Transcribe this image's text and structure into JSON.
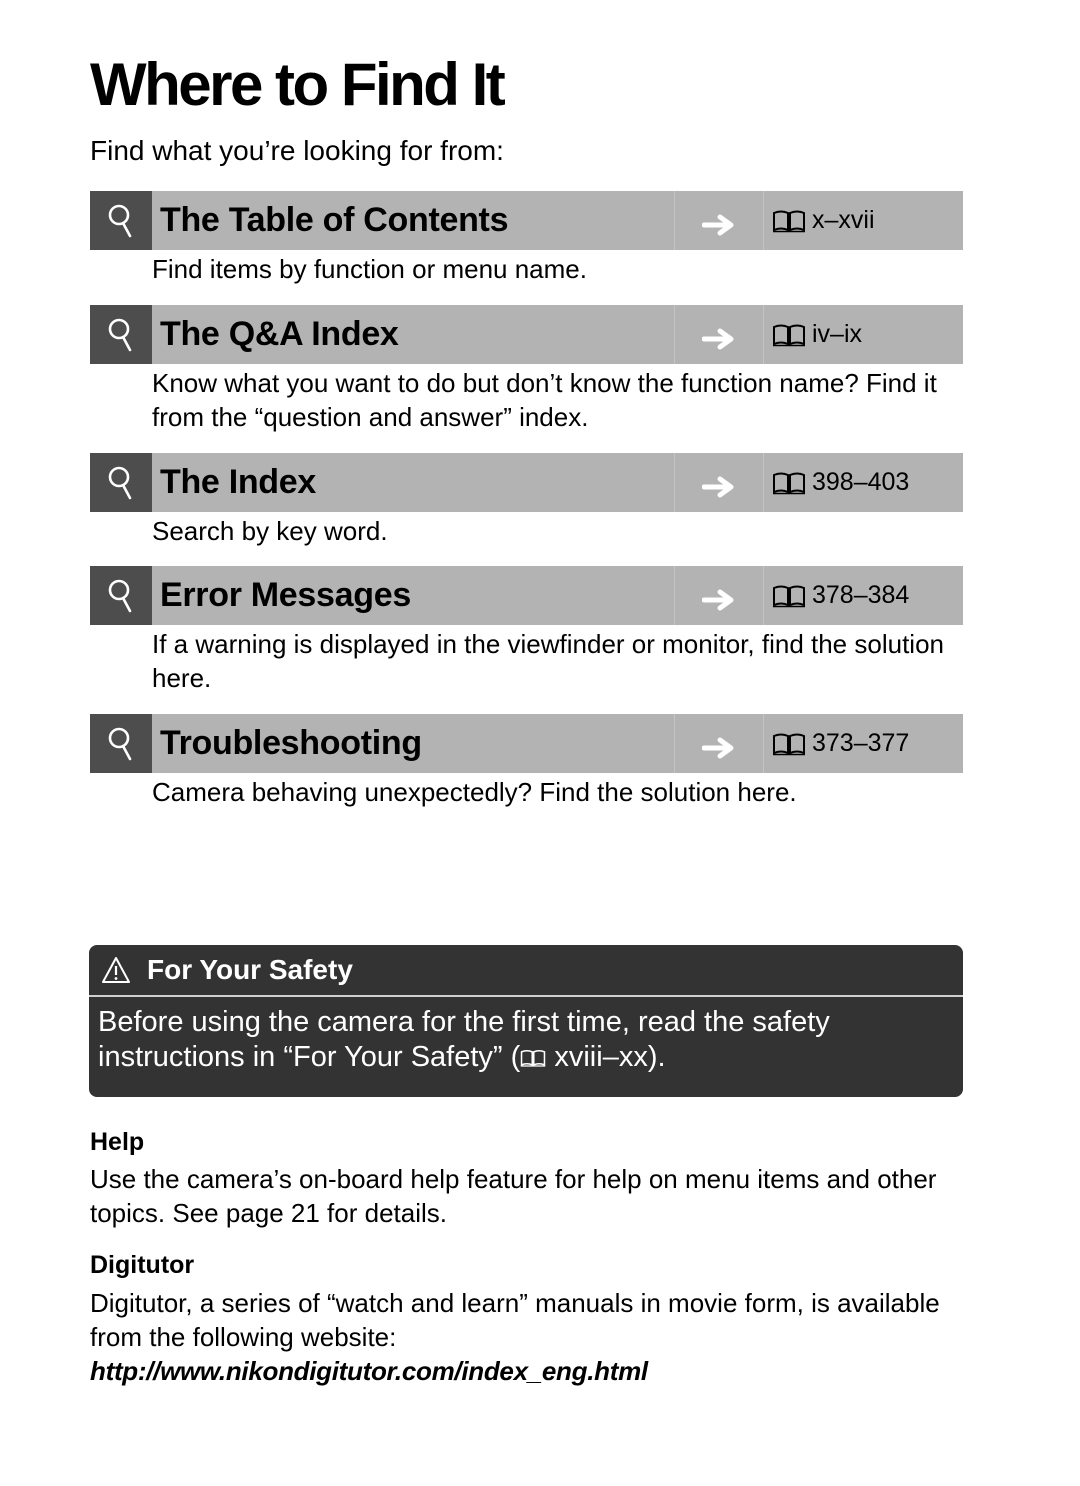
{
  "page": {
    "title": "Where to Find It",
    "intro": "Find what you’re looking for from:"
  },
  "entries": [
    {
      "icon": "magnifier-icon",
      "title": "The Table of Contents",
      "arrow": "right-arrow-icon",
      "page_icon": "book-icon",
      "pages": "x–xvii",
      "description": "Find items by function or menu name."
    },
    {
      "icon": "magnifier-icon",
      "title": "The Q&A Index",
      "arrow": "right-arrow-icon",
      "page_icon": "book-icon",
      "pages": "iv–ix",
      "description": "Know what you want to do but don’t know the function name?  Find it from the “question and answer” index."
    },
    {
      "icon": "magnifier-icon",
      "title": "The Index",
      "arrow": "right-arrow-icon",
      "page_icon": "book-icon",
      "pages": "398–403",
      "description": "Search by key word."
    },
    {
      "icon": "magnifier-icon",
      "title": "Error Messages",
      "arrow": "right-arrow-icon",
      "page_icon": "book-icon",
      "pages": "378–384",
      "description": "If a warning is displayed in the viewfinder or monitor, find the solution here."
    },
    {
      "icon": "magnifier-icon",
      "title": "Troubleshooting",
      "arrow": "right-arrow-icon",
      "page_icon": "book-icon",
      "pages": "373–377",
      "description": "Camera behaving unexpectedly?  Find the solution here."
    }
  ],
  "safety": {
    "icon": "warning-triangle-icon",
    "heading": "For Your Safety",
    "text_before": "Before using the camera for the first time, read the safety instructions in “For Your Safety” (",
    "pages": "xviii–xx",
    "text_after": ")."
  },
  "help": {
    "heading": "Help",
    "text": "Use the camera’s on-board help feature for help on menu items and other topics. See page 21 for details."
  },
  "digitutor": {
    "heading": "Digitutor",
    "text": "Digitutor, a series of “watch and learn” manuals in movie form, is available from the following website:",
    "url": "http://www.nikondigitutor.com/index_eng.html"
  },
  "colors": {
    "bar": "#b3b3b3",
    "icon_block": "#4d4d4d",
    "safety_box": "#333333"
  }
}
